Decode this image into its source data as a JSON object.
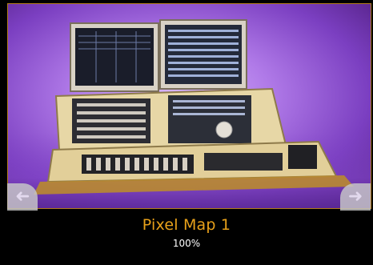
{
  "caption": {
    "title": "Pixel Map 1",
    "zoom": "100%"
  },
  "nav": {
    "prev_icon": "arrow-left-icon",
    "next_icon": "arrow-right-icon",
    "prev_glyph": "➜",
    "next_glyph": "➜"
  },
  "colors": {
    "accent": "#e8a11a",
    "border": "#b07c1a",
    "background": "#000000",
    "nav_button": "#c9c9c9"
  }
}
